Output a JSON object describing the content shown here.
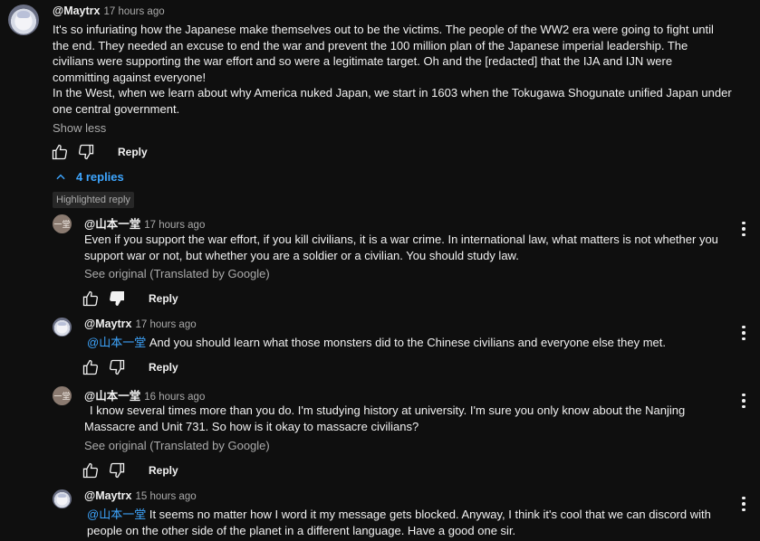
{
  "top_comment": {
    "author": "@Maytrx",
    "time": "17 hours ago",
    "paragraph1": "It's so infuriating how the Japanese make themselves out to be the victims. The people of the WW2 era were going to fight until the end. They needed an excuse to end the war and prevent the 100 million plan of the Japanese imperial leadership. The civilians were supporting the war effort and so were a legitimate target. Oh and the [redacted] that the IJA and IJN were committing against everyone!",
    "paragraph2": "In the West, when we learn about why America nuked Japan, we start in 1603 when the Tokugawa Shogunate unified Japan under one central government.",
    "show_less": "Show less",
    "reply_label": "Reply"
  },
  "replies_toggle": {
    "label": "4 replies"
  },
  "highlight_label": "Highlighted reply",
  "replies": [
    {
      "author": "@山本一堂",
      "time": "17 hours ago",
      "avatar_text": "一堂",
      "mention": "",
      "text": "Even if you support the war effort, if you kill civilians, it is a war crime. In international law, what matters is not whether you support war or not, but whether you are a soldier or a civilian. You should study law.",
      "see_original": "See original (Translated by Google)",
      "reply_label": "Reply"
    },
    {
      "author": "@Maytrx",
      "time": "17 hours ago",
      "mention": "@山本一堂",
      "text": "And you should learn what those monsters did to the Chinese civilians and everyone else they met.",
      "reply_label": "Reply"
    },
    {
      "author": "@山本一堂",
      "time": "16 hours ago",
      "avatar_text": "一堂",
      "mention": "",
      "text": "I know several times more than you do. I'm studying history at university. I'm sure you only know about the Nanjing Massacre and Unit 731. So how is it okay to massacre civilians?",
      "see_original": "See original (Translated by Google)",
      "reply_label": "Reply"
    },
    {
      "author": "@Maytrx",
      "time": "15 hours ago",
      "mention": "@山本一堂",
      "text": "It seems no matter how I word it my message gets blocked. Anyway, I think it's cool that we can discord with people on the other side of the planet in a different language. Have a good one sir."
    }
  ]
}
